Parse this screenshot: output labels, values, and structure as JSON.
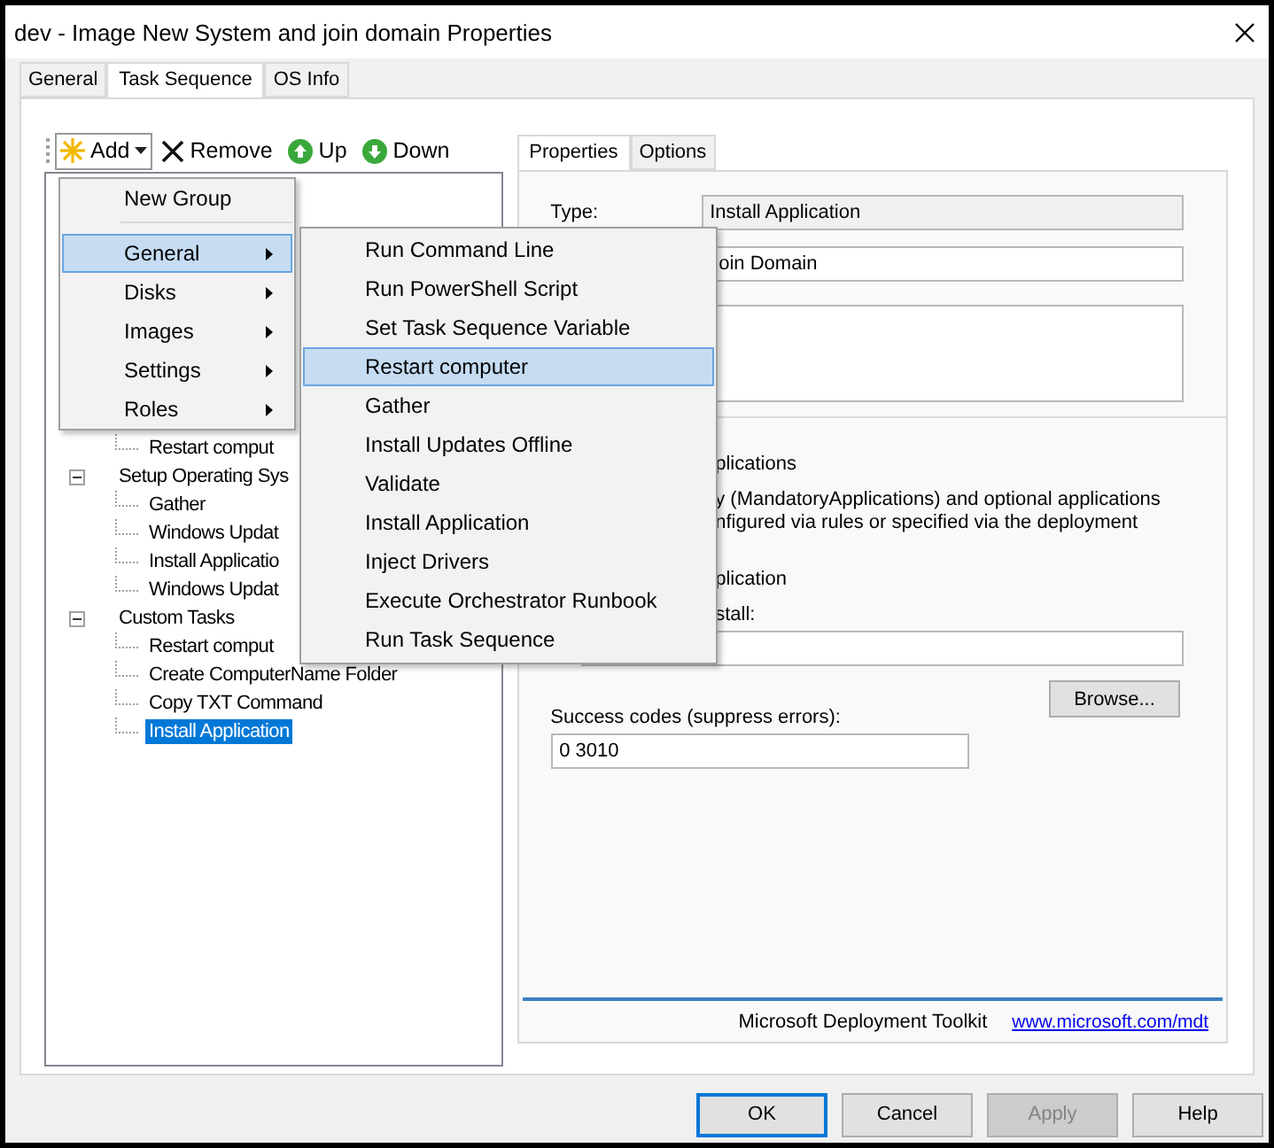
{
  "window": {
    "title": "dev - Image New System and join domain Properties"
  },
  "tabs": [
    {
      "label": "General",
      "selected": false
    },
    {
      "label": "Task Sequence",
      "selected": true
    },
    {
      "label": "OS Info",
      "selected": false
    }
  ],
  "toolbar": [
    {
      "kind": "add",
      "label": "Add"
    },
    {
      "kind": "remove",
      "label": "Remove"
    },
    {
      "kind": "up",
      "label": "Up"
    },
    {
      "kind": "down",
      "label": "Down"
    }
  ],
  "tree": [
    {
      "children": [
        {
          "label": "Restart comput",
          "selected": false
        }
      ]
    },
    {
      "label": "Setup Operating Sys",
      "expanded": true,
      "children": [
        {
          "label": "Gather",
          "selected": false
        },
        {
          "label": "Windows Updat",
          "selected": false
        },
        {
          "label": "Install Applicatio",
          "selected": false
        },
        {
          "label": "Windows Updat",
          "selected": false
        }
      ]
    },
    {
      "label": "Custom Tasks",
      "expanded": true,
      "children": [
        {
          "label": "Restart comput",
          "selected": false
        },
        {
          "label": "Create ComputerName Folder",
          "selected": false
        },
        {
          "label": "Copy TXT Command",
          "selected": false
        },
        {
          "label": "Install Application",
          "selected": true
        }
      ]
    }
  ],
  "add_menu": [
    {
      "kind": "item",
      "label": "New Group",
      "selected": false,
      "submenu": false
    },
    {
      "kind": "separator"
    },
    {
      "kind": "item",
      "label": "General",
      "selected": true,
      "submenu": true
    },
    {
      "kind": "item",
      "label": "Disks",
      "selected": false,
      "submenu": true
    },
    {
      "kind": "item",
      "label": "Images",
      "selected": false,
      "submenu": true
    },
    {
      "kind": "item",
      "label": "Settings",
      "selected": false,
      "submenu": true
    },
    {
      "kind": "item",
      "label": "Roles",
      "selected": false,
      "submenu": true
    }
  ],
  "general_menu": [
    {
      "label": "Run Command Line",
      "selected": false
    },
    {
      "label": "Run PowerShell Script",
      "selected": false
    },
    {
      "label": "Set Task Sequence Variable",
      "selected": false
    },
    {
      "label": "Restart computer",
      "selected": true
    },
    {
      "label": "Gather",
      "selected": false
    },
    {
      "label": "Install Updates Offline",
      "selected": false
    },
    {
      "label": "Validate",
      "selected": false
    },
    {
      "label": "Install Application",
      "selected": false
    },
    {
      "label": "Inject Drivers",
      "selected": false
    },
    {
      "label": "Execute Orchestrator Runbook",
      "selected": false
    },
    {
      "label": "Run Task Sequence",
      "selected": false
    }
  ],
  "properties_tabs": [
    {
      "label": "Properties",
      "selected": true
    },
    {
      "label": "Options",
      "selected": false
    }
  ],
  "properties": {
    "type_label": "Type:",
    "type_value": "Install Application",
    "name_value": "oin Domain",
    "section_1": "plications",
    "paragraph_lines": [
      "y (MandatoryApplications) and optional applications",
      "nfigured via rules or specified via the deployment"
    ],
    "section_2": "plication",
    "install_label": "stall:",
    "browse_button": "Browse...",
    "success_label": "Success codes (suppress errors):",
    "success_value": "0 3010"
  },
  "footer": {
    "text": "Microsoft Deployment Toolkit",
    "link": "www.microsoft.com/mdt"
  },
  "buttons": [
    {
      "label": "OK",
      "focused": true,
      "disabled": false
    },
    {
      "label": "Cancel",
      "focused": false,
      "disabled": false
    },
    {
      "label": "Apply",
      "focused": false,
      "disabled": true
    },
    {
      "label": "Help",
      "focused": false,
      "disabled": false
    }
  ]
}
